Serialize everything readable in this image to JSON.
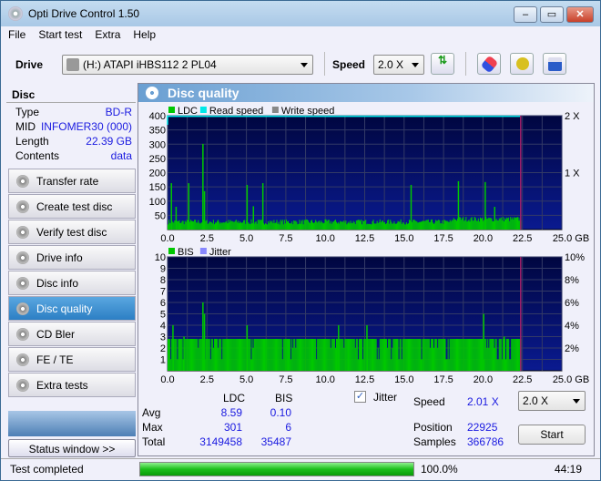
{
  "window": {
    "title": "Opti Drive Control 1.50",
    "controls": [
      "minimize",
      "maximize",
      "close"
    ]
  },
  "menu": [
    "File",
    "Start test",
    "Extra",
    "Help"
  ],
  "toolbar": {
    "drive_label": "Drive",
    "drive_value": "(H:)   ATAPI iHBS112   2 PL04",
    "speed_label": "Speed",
    "speed_value": "2.0 X",
    "icons": [
      "refresh-icon",
      "eraser-icon",
      "chip-icon",
      "save-icon"
    ]
  },
  "disc": {
    "header": "Disc",
    "rows": [
      {
        "k": "Type",
        "v": "BD-R"
      },
      {
        "k": "MID",
        "v": "INFOMER30 (000)"
      },
      {
        "k": "Length",
        "v": "22.39 GB"
      },
      {
        "k": "Contents",
        "v": "data"
      }
    ]
  },
  "nav": [
    "Transfer rate",
    "Create test disc",
    "Verify test disc",
    "Drive info",
    "Disc info",
    "Disc quality",
    "CD Bler",
    "FE / TE",
    "Extra tests"
  ],
  "nav_active": "Disc quality",
  "status_window_button": "Status window >>",
  "panel_title": "Disc quality",
  "colors": {
    "ldc": "#00c800",
    "read": "#00e8e8",
    "write": "#888888",
    "bis": "#00c800",
    "jitter": "#8888ff",
    "plot_bg": "#000a60",
    "end_marker": "#a0206a"
  },
  "chart_data": [
    {
      "type": "bar",
      "legend": [
        "LDC",
        "Read speed",
        "Write speed"
      ],
      "ylim": [
        0,
        400
      ],
      "yticks": [
        "400",
        "350",
        "300",
        "250",
        "200",
        "150",
        "100",
        "50"
      ],
      "y2ticks": [
        "2 X",
        "1 X"
      ],
      "xlim": [
        0,
        25
      ],
      "xticks": [
        "0.0",
        "2.5",
        "5.0",
        "7.5",
        "10.0",
        "12.5",
        "15.0",
        "17.5",
        "20.0",
        "22.5",
        "25.0 GB"
      ],
      "data_end": 22.39,
      "baseline": 30,
      "read_speed_x": 2.0,
      "spikes": [
        [
          0.2,
          163
        ],
        [
          0.5,
          80
        ],
        [
          1.3,
          163
        ],
        [
          2.2,
          301
        ],
        [
          2.3,
          135
        ],
        [
          5.0,
          157
        ],
        [
          5.4,
          82
        ],
        [
          6.0,
          163
        ],
        [
          15.4,
          157
        ],
        [
          18.4,
          170
        ],
        [
          20.1,
          167
        ],
        [
          20.7,
          80
        ]
      ]
    },
    {
      "type": "bar",
      "legend": [
        "BIS",
        "Jitter"
      ],
      "ylim": [
        0,
        10
      ],
      "yticks": [
        "10",
        "9",
        "8",
        "7",
        "6",
        "5",
        "4",
        "3",
        "2",
        "1"
      ],
      "y2ticks": [
        "10%",
        "8%",
        "6%",
        "4%",
        "2%"
      ],
      "xlim": [
        0,
        25
      ],
      "xticks": [
        "0.0",
        "2.5",
        "5.0",
        "7.5",
        "10.0",
        "12.5",
        "15.0",
        "17.5",
        "20.0",
        "22.5",
        "25.0 GB"
      ],
      "data_end": 22.39,
      "baseline": 2.5,
      "spikes": [
        [
          0.3,
          4
        ],
        [
          1.0,
          3
        ],
        [
          2.2,
          6
        ],
        [
          2.3,
          5
        ],
        [
          5.0,
          4
        ],
        [
          10.8,
          4
        ],
        [
          12.6,
          4
        ],
        [
          20.0,
          5
        ],
        [
          21.3,
          3
        ]
      ]
    }
  ],
  "stats": {
    "col_ldc": "LDC",
    "col_bis": "BIS",
    "rows": [
      {
        "k": "Avg",
        "ldc": "8.59",
        "bis": "0.10"
      },
      {
        "k": "Max",
        "ldc": "301",
        "bis": "6"
      },
      {
        "k": "Total",
        "ldc": "3149458",
        "bis": "35487"
      }
    ],
    "jitter_label": "Jitter",
    "jitter_checked": true,
    "speed_label": "Speed",
    "speed_value": "2.01 X",
    "position_label": "Position",
    "position_value": "22925",
    "samples_label": "Samples",
    "samples_value": "366786",
    "speed_select": "2.0 X",
    "start_button": "Start"
  },
  "status": {
    "text": "Test completed",
    "progress": 100,
    "progress_text": "100.0%",
    "time": "44:19"
  }
}
